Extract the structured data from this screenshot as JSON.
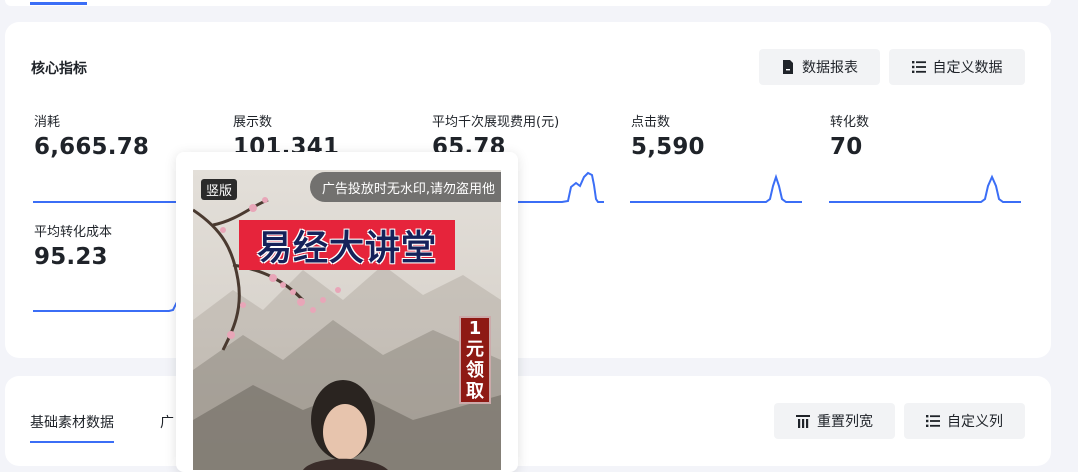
{
  "metrics_card": {
    "title": "核心指标",
    "report_button": "数据报表",
    "custom_data_button": "自定义数据",
    "metrics": [
      {
        "label": "消耗",
        "value": "6,665.78"
      },
      {
        "label": "展示数",
        "value": "101,341"
      },
      {
        "label": "平均千次展现费用(元)",
        "value": "65.78"
      },
      {
        "label": "点击数",
        "value": "5,590"
      },
      {
        "label": "转化数",
        "value": "70"
      },
      {
        "label": "平均转化成本",
        "value": "95.23"
      }
    ]
  },
  "assets_card": {
    "tab_active": "基础素材数据",
    "tab_second": "广",
    "reset_width_button": "重置列宽",
    "custom_columns_button": "自定义列"
  },
  "preview": {
    "badge": "竖版",
    "watermark": "广告投放时无水印,请勿盗用他",
    "title": "易经大讲堂",
    "seal_chars": [
      "1",
      "元",
      "领",
      "取"
    ]
  },
  "colors": {
    "accent": "#3b6ef6",
    "sparkline": "#3b6ef6",
    "title_banner": "#e6243b",
    "seal": "#8e1a14"
  },
  "icons": {
    "report": "document-icon",
    "custom_data": "list-icon",
    "reset_width": "column-width-icon",
    "custom_columns": "list-icon"
  }
}
